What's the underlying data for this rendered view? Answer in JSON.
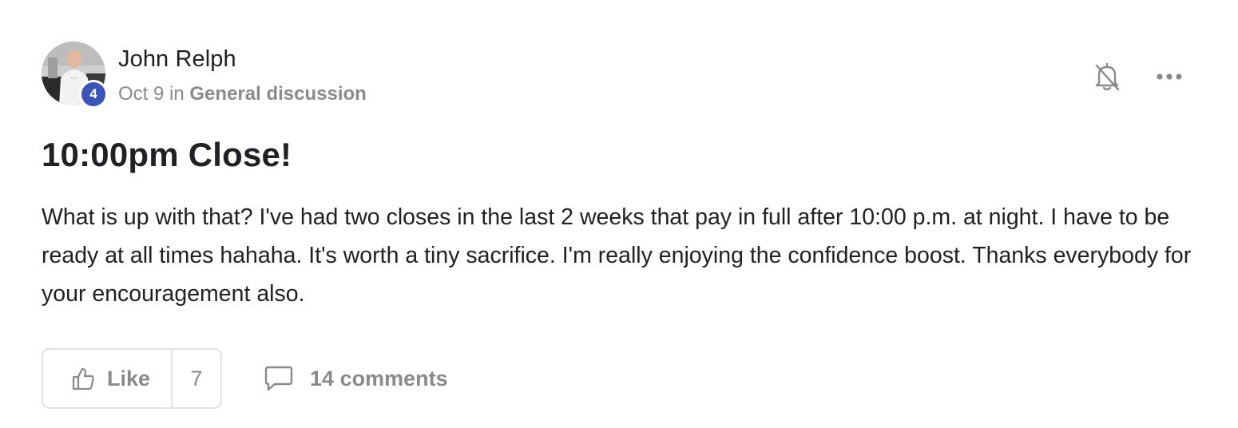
{
  "post": {
    "author": {
      "name": "John Relph",
      "level": "4",
      "avatar_alt": "avatar-photo"
    },
    "meta": {
      "date": "Oct 9",
      "in_word": "in",
      "category": "General discussion"
    },
    "title": "10:00pm Close!",
    "body": "What is up with that? I've had two closes in the last 2 weeks that pay in full after 10:00 p.m. at night. I have to be ready at all times hahaha. It's worth a tiny sacrifice. I'm really enjoying the confidence boost. Thanks everybody for your encouragement also.",
    "actions": {
      "like_label": "Like",
      "like_count": "7",
      "comments_label": "14 comments"
    },
    "icons": {
      "bell": "bell-off-icon",
      "more": "more-horizontal-icon",
      "like": "thumbs-up-icon",
      "comments": "comment-bubble-icon"
    },
    "colors": {
      "level_badge": "#3d54b5",
      "muted_text": "#8a8a8a",
      "border": "#e2e2e2"
    }
  }
}
